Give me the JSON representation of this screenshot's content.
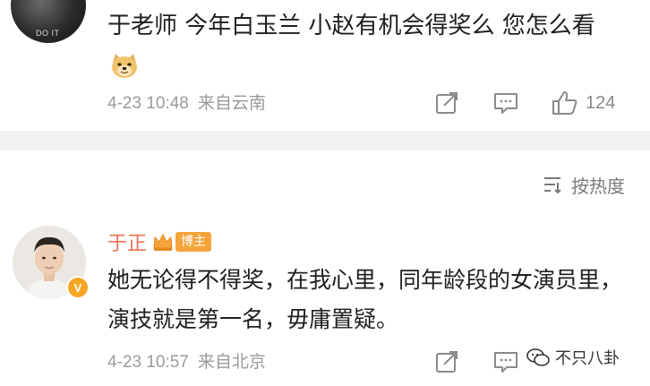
{
  "top_comment": {
    "avatar_watermark": "DO IT",
    "text": "于老师 今年白玉兰 小赵有机会得奖么 您怎么看",
    "time": "4-23 10:48",
    "location": "来自云南",
    "like_count": "124",
    "emoji_icon": "doge-emoji-icon"
  },
  "sort": {
    "label": "按热度"
  },
  "reply_comment": {
    "author": "于正",
    "badge_label": "博主",
    "verified_mark": "V",
    "text": "她无论得不得奖，在我心里，同年龄段的女演员里，演技就是第一名，毋庸置疑。",
    "time": "4-23 10:57",
    "location": "来自北京"
  },
  "watermark": {
    "text": "不只八卦"
  },
  "colors": {
    "author": "#eb7350",
    "badge": "#f4a43a",
    "meta": "#9a9a9a",
    "divider": "#f2f2f2"
  }
}
